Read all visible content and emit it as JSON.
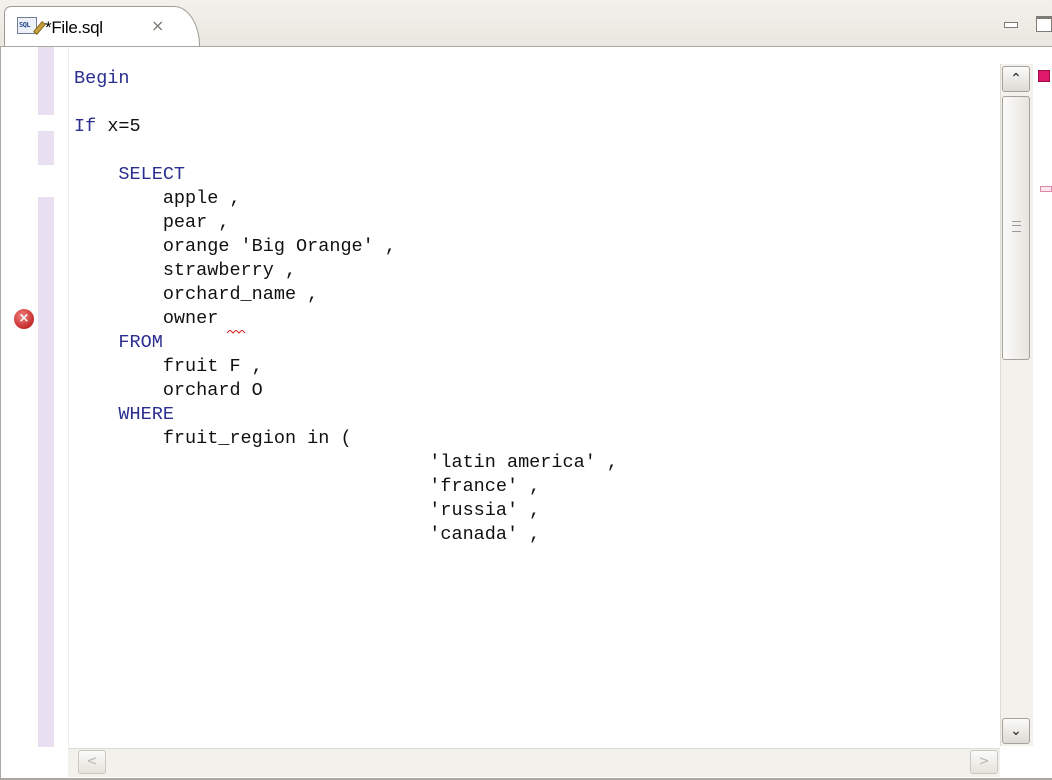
{
  "tab": {
    "title": "*File.sql",
    "icon": "sql-file-icon",
    "icon_text": "SQL",
    "close_glyph": "×"
  },
  "editor": {
    "lines": [
      {
        "indent": "",
        "kw": "Begin",
        "rest": ""
      },
      {
        "indent": "",
        "kw": "",
        "rest": ""
      },
      {
        "indent": "",
        "kw": "If",
        "rest": " x=5"
      },
      {
        "indent": "",
        "kw": "",
        "rest": ""
      },
      {
        "indent": "    ",
        "kw": "SELECT",
        "rest": ""
      },
      {
        "indent": "        ",
        "kw": "",
        "rest": "apple ,"
      },
      {
        "indent": "        ",
        "kw": "",
        "rest": "pear ,"
      },
      {
        "indent": "        ",
        "kw": "",
        "rest": "orange 'Big Orange' ,"
      },
      {
        "indent": "        ",
        "kw": "",
        "rest": "strawberry ,"
      },
      {
        "indent": "        ",
        "kw": "",
        "rest": "orchard_name ,"
      },
      {
        "indent": "        ",
        "kw": "",
        "rest": "owner"
      },
      {
        "indent": "    ",
        "kw": "FROM",
        "rest": ""
      },
      {
        "indent": "        ",
        "kw": "",
        "rest": "fruit F ,"
      },
      {
        "indent": "        ",
        "kw": "",
        "rest": "orchard O"
      },
      {
        "indent": "    ",
        "kw": "WHERE",
        "rest": ""
      },
      {
        "indent": "        ",
        "kw": "",
        "rest": "fruit_region in ("
      },
      {
        "indent": "                                ",
        "kw": "",
        "rest": "'latin america' ,"
      },
      {
        "indent": "                                ",
        "kw": "",
        "rest": "'france' ,"
      },
      {
        "indent": "                                ",
        "kw": "",
        "rest": "'russia' ,"
      },
      {
        "indent": "                                ",
        "kw": "",
        "rest": "'canada' ,"
      }
    ],
    "error_glyph": "×"
  },
  "scrollbars": {
    "up_glyph": "⌃",
    "down_glyph": "⌄",
    "left_glyph": "<",
    "right_glyph": ">"
  },
  "colors": {
    "keyword": "#2b2f8f",
    "error": "#e0186a",
    "gutter_strip": "#e8dff0"
  }
}
